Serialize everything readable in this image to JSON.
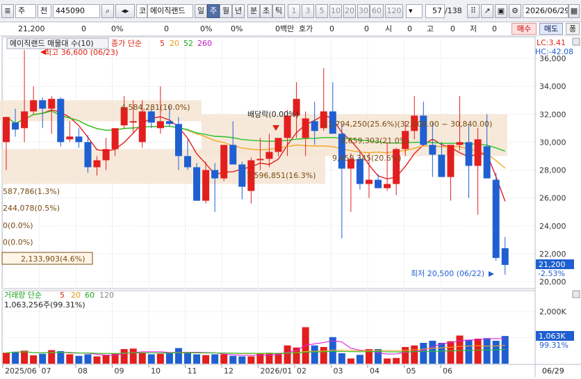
{
  "toolbar": {
    "mode": "주",
    "prev_label": "전",
    "code": "445090",
    "broker_label": "코",
    "stock_name": "에이직랜드",
    "period_tabs": [
      "일",
      "주",
      "월",
      "년",
      "분",
      "초",
      "틱"
    ],
    "selected_period": "주",
    "minute_options": [
      "1",
      "3",
      "5",
      "10",
      "20",
      "30",
      "60",
      "120"
    ],
    "count": "57",
    "total": "/138",
    "date": "2026/06/29"
  },
  "info_bar": {
    "price": "21,200",
    "vals": [
      "0",
      "0%",
      "0",
      "0%",
      "0%",
      "0백만",
      "호가",
      "0",
      "0",
      "시",
      "0",
      "고",
      "0",
      "저",
      "0"
    ],
    "buy_label": "매수",
    "sell_label": "매도",
    "settings_label": "퐁"
  },
  "price_panel": {
    "title": "에이직랜드 매물대 수(10)",
    "ma_label": "종가 단순",
    "ma_periods": [
      "5",
      "20",
      "52",
      "260"
    ],
    "ma_colors": [
      "#e31e1e",
      "#f5a623",
      "#27c227",
      "#e020e0"
    ],
    "lc_label": "LC:3.41",
    "hc_label": "HC:-42.08",
    "high_label": "최고 36,600 (06/23)",
    "low_label": "최저 20,500 (06/22)",
    "dividend_label": "배당락(0.00%)",
    "current_price": "21,200",
    "change_label": "-2.53%",
    "volume_profile": [
      "587,786(1.3%)",
      "244,078(0.5%)",
      "0(0.0%)",
      "0(0.0%)",
      "2,133,903(4.6%)",
      "7,596,851(16.3%)",
      "9,459,345(20.6%)",
      "9,659,303(21.0%)",
      "11,794,250(25.6%)(32,000.00 ~ 30,840.00)",
      "4,584,281(10.0%)"
    ],
    "y_ticks": [
      "36,000",
      "34,000",
      "32,000",
      "30,000",
      "28,000",
      "26,000",
      "24,000",
      "22,000",
      "20,000"
    ]
  },
  "volume_panel": {
    "title": "거래량 단순",
    "ma_periods": [
      "5",
      "20",
      "60",
      "120"
    ],
    "ma_colors": [
      "#e31e1e",
      "#f5a623",
      "#27c227",
      "#9a9a9a"
    ],
    "summary": "1,063,256주(99.31%)",
    "y_ticks": [
      "2,000K",
      "1,000K"
    ],
    "current": "1,063K",
    "current_pct": "99.31%"
  },
  "x_axis": {
    "labels": [
      "2025/06",
      "07",
      "08",
      "09",
      "10",
      "11",
      "12",
      "2026/01",
      "02",
      "03",
      "04",
      "05",
      "06"
    ],
    "end_label": "06/29"
  },
  "colors": {
    "up": "#e31e1e",
    "down": "#1f5fd1",
    "band": "#f5e5d3",
    "profile_text": "#7a4b12",
    "accent": "#4f6fa6"
  },
  "chart_data": {
    "type": "candlestick",
    "ohlc": [
      [
        30000,
        31800,
        28000,
        31800
      ],
      [
        31400,
        32400,
        30400,
        30900
      ],
      [
        31000,
        36600,
        30000,
        32200
      ],
      [
        32200,
        34000,
        32000,
        33000
      ],
      [
        33000,
        33200,
        31000,
        32400
      ],
      [
        32400,
        33300,
        30600,
        33100
      ],
      [
        33100,
        33200,
        29700,
        30000
      ],
      [
        30200,
        31500,
        30000,
        30400
      ],
      [
        30400,
        31000,
        29600,
        30000
      ],
      [
        30000,
        30500,
        27800,
        28200
      ],
      [
        28200,
        29000,
        27600,
        28700
      ],
      [
        28700,
        30300,
        28000,
        29500
      ],
      [
        29500,
        30700,
        29000,
        31000
      ],
      [
        31200,
        33300,
        31000,
        32500
      ],
      [
        31400,
        33000,
        30700,
        31500
      ],
      [
        30000,
        33000,
        29600,
        32200
      ],
      [
        32200,
        32400,
        31000,
        31400
      ],
      [
        31000,
        34000,
        30600,
        31500
      ],
      [
        31500,
        32600,
        31100,
        31300
      ],
      [
        31300,
        31800,
        28000,
        29000
      ],
      [
        29000,
        30200,
        28000,
        28200
      ],
      [
        28200,
        28500,
        25800,
        25800
      ],
      [
        25800,
        28600,
        25600,
        28000
      ],
      [
        28000,
        28500,
        25000,
        27400
      ],
      [
        27400,
        29700,
        27200,
        29800
      ],
      [
        29800,
        31500,
        29000,
        28400
      ],
      [
        28400,
        28600,
        25900,
        26800
      ],
      [
        26500,
        28900,
        25600,
        28700
      ],
      [
        28700,
        30300,
        28000,
        28800
      ],
      [
        28800,
        30600,
        28200,
        29300
      ],
      [
        29300,
        30300,
        29000,
        30300
      ],
      [
        30300,
        32300,
        29000,
        31900
      ],
      [
        31900,
        34300,
        30300,
        33100
      ],
      [
        30300,
        32200,
        29000,
        31700
      ],
      [
        31500,
        32900,
        29800,
        30800
      ],
      [
        31000,
        35300,
        30800,
        32200
      ],
      [
        32200,
        34300,
        31000,
        30600
      ],
      [
        30600,
        31300,
        23100,
        28100
      ],
      [
        28100,
        29200,
        25000,
        28800
      ],
      [
        28800,
        29300,
        26600,
        27000
      ],
      [
        27000,
        29200,
        26000,
        27300
      ],
      [
        27300,
        27700,
        26700,
        26700
      ],
      [
        26700,
        30000,
        26500,
        27000
      ],
      [
        27000,
        29600,
        26200,
        29500
      ],
      [
        29500,
        31500,
        29000,
        30800
      ],
      [
        30800,
        33300,
        30200,
        31900
      ],
      [
        31900,
        32900,
        31000,
        29800
      ],
      [
        29800,
        31400,
        27500,
        29100
      ],
      [
        29100,
        30000,
        28800,
        27500
      ],
      [
        27500,
        29500,
        25800,
        29800
      ],
      [
        29800,
        33300,
        29400,
        30000
      ],
      [
        30000,
        31200,
        26000,
        28300
      ],
      [
        28300,
        31000,
        24800,
        30200
      ],
      [
        29700,
        32000,
        27800,
        27400
      ],
      [
        27300,
        27800,
        21500,
        21700
      ],
      [
        22400,
        23200,
        20500,
        21200
      ]
    ],
    "volume_k": [
      420,
      460,
      500,
      320,
      380,
      520,
      480,
      360,
      300,
      360,
      280,
      340,
      380,
      560,
      580,
      420,
      360,
      380,
      400,
      600,
      440,
      360,
      330,
      360,
      360,
      300,
      280,
      280,
      380,
      420,
      400,
      700,
      620,
      1400,
      700,
      640,
      1020,
      400,
      200,
      340,
      560,
      560,
      200,
      220,
      640,
      700,
      800,
      880,
      800,
      860,
      1080,
      920,
      960,
      980,
      880,
      1063
    ],
    "ylim": [
      20000,
      36600
    ],
    "volume_ylim": [
      0,
      2400
    ]
  }
}
